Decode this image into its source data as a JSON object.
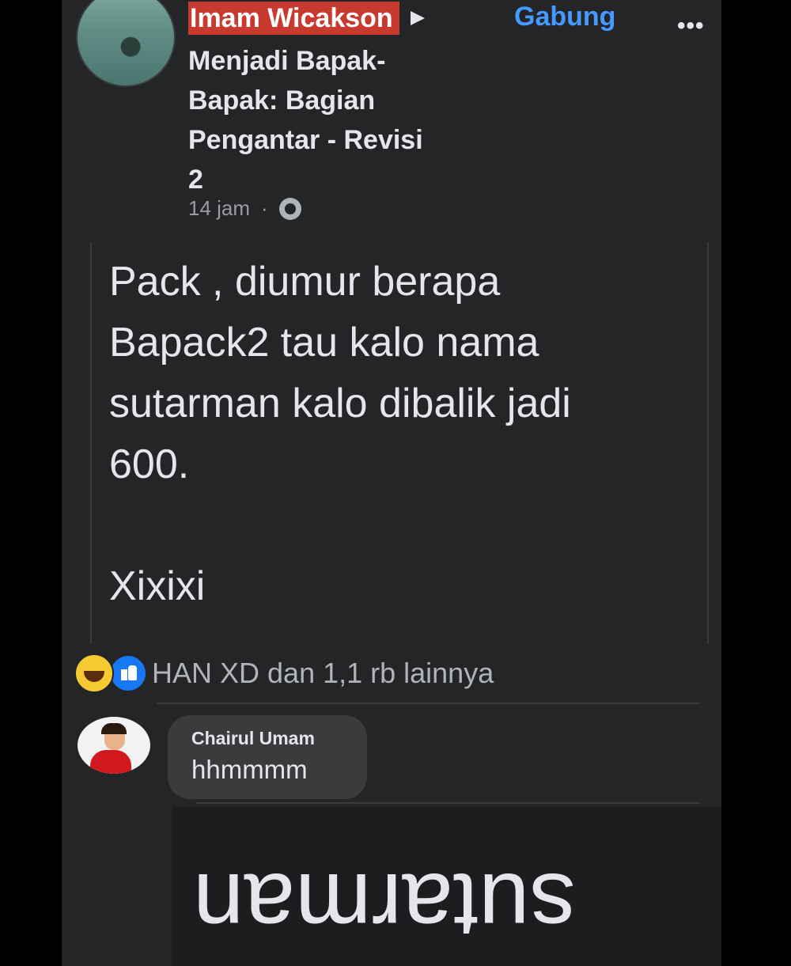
{
  "post": {
    "author": "Imam Wicakson",
    "join_label": "Gabung",
    "more_label": "•••",
    "group": "Menjadi Bapak-\nBapak: Bagian\nPengantar - Revisi\n2",
    "time": "14 jam",
    "separator": "·",
    "text": "Pack , diumur berapa\nBapack2 tau kalo nama\nsutarman kalo dibalik jadi\n600.\n\nXixixi"
  },
  "reactions": {
    "summary": "HAN XD dan 1,1 rb lainnya",
    "icons": [
      "haha-icon",
      "like-icon"
    ]
  },
  "comment": {
    "name": "Chairul Umam",
    "text": "hhmmmm"
  },
  "overlay": {
    "upside_down_text": "sutarman"
  },
  "colors": {
    "background": "#242526",
    "name_highlight": "#c93a2e",
    "join_blue": "#4599ff",
    "text": "#e4e6eb"
  }
}
